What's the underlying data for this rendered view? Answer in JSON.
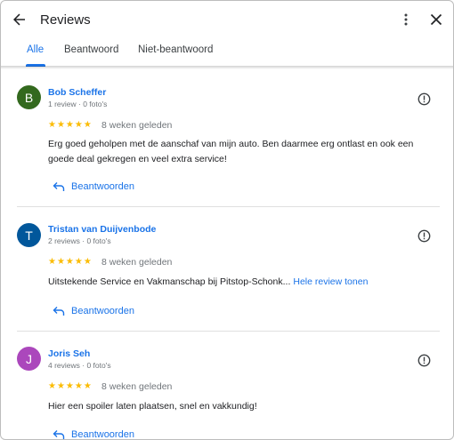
{
  "header": {
    "title": "Reviews",
    "back_icon": "arrow-back-icon",
    "more_icon": "more-vertical-icon",
    "close_icon": "close-icon"
  },
  "tabs": [
    {
      "label": "Alle",
      "active": true
    },
    {
      "label": "Beantwoord",
      "active": false
    },
    {
      "label": "Niet-beantwoord",
      "active": false
    }
  ],
  "reviews": [
    {
      "initial": "B",
      "avatar_color": "#33691e",
      "author": "Bob Scheffer",
      "meta": "1 review · 0 foto's",
      "stars": "★★★★★",
      "rating": 5,
      "date": "8 weken geleden",
      "text": "Erg goed geholpen met de aanschaf van mijn auto. Ben daarmee erg ontlast en ook een goede deal gekregen en veel extra service!",
      "more_link": "",
      "reply_label": "Beantwoorden"
    },
    {
      "initial": "T",
      "avatar_color": "#01579b",
      "author": "Tristan van Duijvenbode",
      "meta": "2 reviews · 0 foto's",
      "stars": "★★★★★",
      "rating": 5,
      "date": "8 weken geleden",
      "text": "Uitstekende Service en Vakmanschap bij Pitstop-Schonk...",
      "more_link": "Hele review tonen",
      "reply_label": "Beantwoorden"
    },
    {
      "initial": "J",
      "avatar_color": "#ab47bc",
      "author": "Joris Seh",
      "meta": "4 reviews · 0 foto's",
      "stars": "★★★★★",
      "rating": 5,
      "date": "8 weken geleden",
      "text": "Hier een spoiler laten plaatsen, snel en vakkundig!",
      "more_link": "",
      "reply_label": "Beantwoorden"
    }
  ]
}
